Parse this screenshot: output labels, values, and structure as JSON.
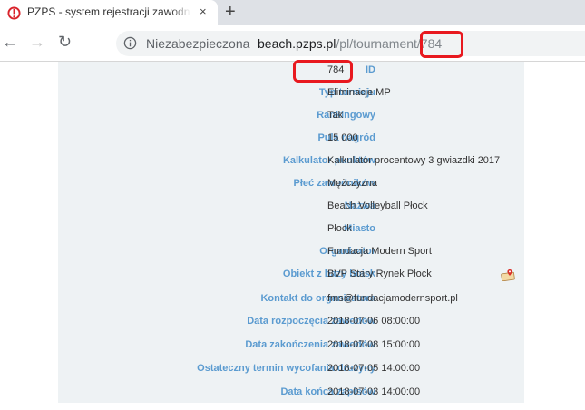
{
  "browser": {
    "tab_title": "PZPS - system rejestracji zawodników",
    "tab_close": "×",
    "new_tab": "+",
    "nav_back": "←",
    "nav_forward": "→",
    "nav_reload": "↻",
    "security_label": "Niezabezpieczona",
    "url_host": "beach.pzps.pl",
    "url_path": "/pl/tournament/784"
  },
  "tournament": {
    "rows": [
      {
        "label": "ID",
        "value": "784"
      },
      {
        "label": "Typ turnieju",
        "value": "Eliminacje MP"
      },
      {
        "label": "Rankingowy",
        "value": "Tak"
      },
      {
        "label": "Pula nagród",
        "value": "15 000"
      },
      {
        "label": "Kalkulator punktów",
        "value": "Kalkulator procentowy 3 gwiazdki 2017"
      },
      {
        "label": "Płeć zawodników",
        "value": "Mężczyzna"
      },
      {
        "label": "Nazwa",
        "value": "Beach Volleyball Płock"
      },
      {
        "label": "Miasto",
        "value": "Płock"
      },
      {
        "label": "Organizator",
        "value": "Fundacja Modern Sport"
      },
      {
        "label": "Obiekt z bazy boisk",
        "value": "BVP Stary Rynek Płock"
      },
      {
        "label": "Kontakt do organizatora",
        "value": "fms@fundacjamodernsport.pl"
      },
      {
        "label": "Data rozpoczęcia zawodów",
        "value": "2018-07-06 08:00:00"
      },
      {
        "label": "Data zakończenia zawodów",
        "value": "2018-07-08 15:00:00"
      },
      {
        "label": "Ostateczny termin wycofania drużyny",
        "value": "2018-07-05 14:00:00"
      },
      {
        "label": "Data końca zapisów",
        "value": "2018-07-03 14:00:00"
      }
    ]
  },
  "colors": {
    "label": "#5b9bd0",
    "highlight": "#e8191f",
    "panel": "#eef2f4"
  }
}
